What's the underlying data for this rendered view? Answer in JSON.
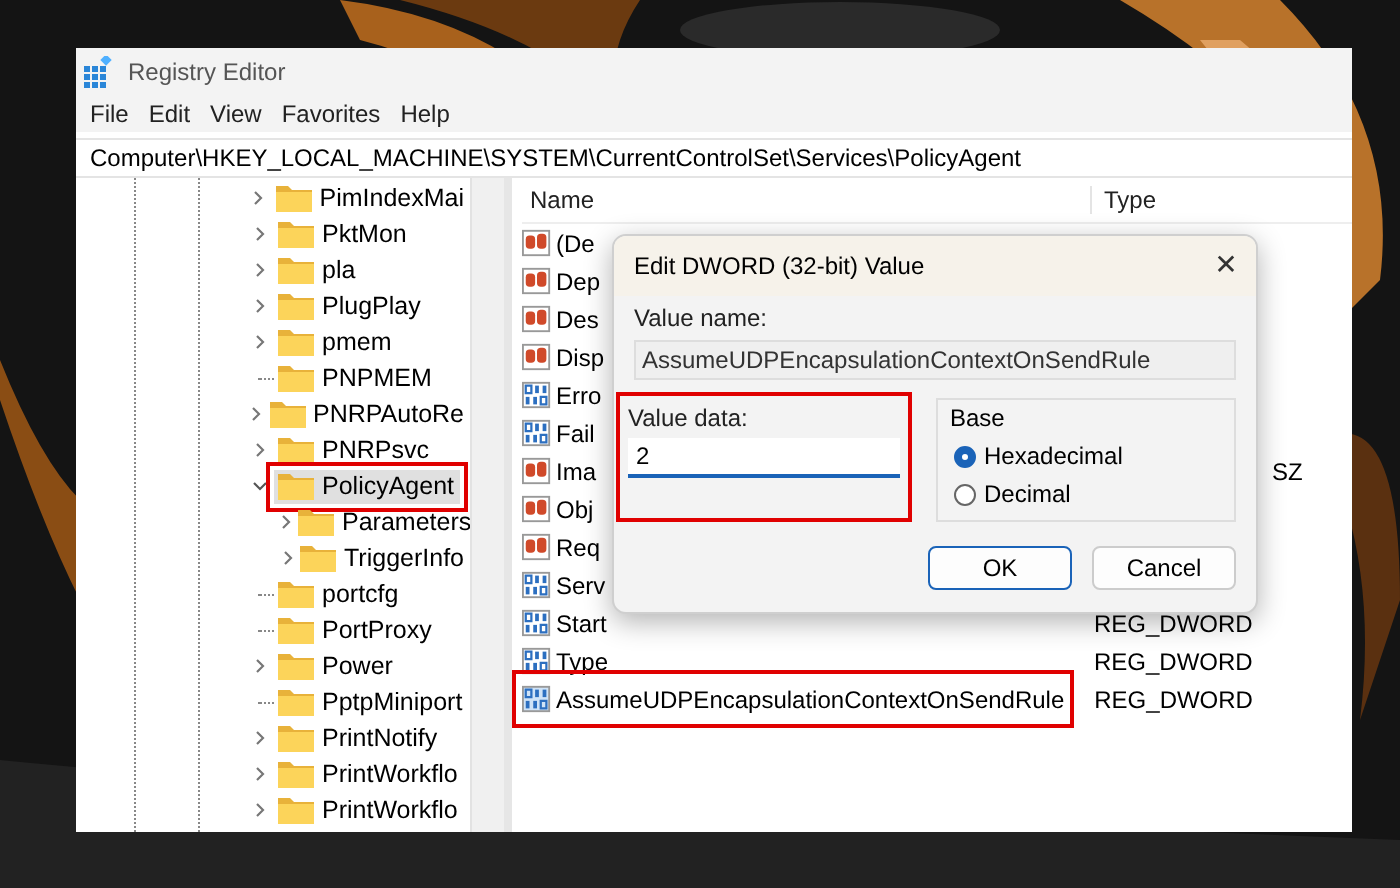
{
  "window": {
    "title": "Registry Editor"
  },
  "menu": [
    "File",
    "Edit",
    "View",
    "Favorites",
    "Help"
  ],
  "address": "Computer\\HKEY_LOCAL_MACHINE\\SYSTEM\\CurrentControlSet\\Services\\PolicyAgent",
  "tree": [
    {
      "label": "PimIndexMai",
      "has_children": true,
      "expanded": false,
      "selected": false,
      "highlighted": false
    },
    {
      "label": "PktMon",
      "has_children": true,
      "expanded": false,
      "selected": false,
      "highlighted": false
    },
    {
      "label": "pla",
      "has_children": true,
      "expanded": false,
      "selected": false,
      "highlighted": false
    },
    {
      "label": "PlugPlay",
      "has_children": true,
      "expanded": false,
      "selected": false,
      "highlighted": false
    },
    {
      "label": "pmem",
      "has_children": true,
      "expanded": false,
      "selected": false,
      "highlighted": false
    },
    {
      "label": "PNPMEM",
      "has_children": false,
      "selected": false,
      "highlighted": false
    },
    {
      "label": "PNRPAutoRe",
      "has_children": true,
      "expanded": false,
      "selected": false,
      "highlighted": false
    },
    {
      "label": "PNRPsvc",
      "has_children": true,
      "expanded": false,
      "selected": false,
      "highlighted": false
    },
    {
      "label": "PolicyAgent",
      "has_children": true,
      "expanded": true,
      "selected": true,
      "highlighted": true,
      "children": [
        {
          "label": "Parameters",
          "has_children": true,
          "expanded": false,
          "selected": false,
          "highlighted": false
        },
        {
          "label": "TriggerInfo",
          "has_children": true,
          "expanded": false,
          "selected": false,
          "highlighted": false
        }
      ]
    },
    {
      "label": "portcfg",
      "has_children": false,
      "selected": false,
      "highlighted": false
    },
    {
      "label": "PortProxy",
      "has_children": false,
      "selected": false,
      "highlighted": false
    },
    {
      "label": "Power",
      "has_children": true,
      "expanded": false,
      "selected": false,
      "highlighted": false
    },
    {
      "label": "PptpMiniport",
      "has_children": false,
      "selected": false,
      "highlighted": false
    },
    {
      "label": "PrintNotify",
      "has_children": true,
      "expanded": false,
      "selected": false,
      "highlighted": false
    },
    {
      "label": "PrintWorkflo",
      "has_children": true,
      "expanded": false,
      "selected": false,
      "highlighted": false
    },
    {
      "label": "PrintWorkflo",
      "has_children": true,
      "expanded": false,
      "selected": false,
      "highlighted": false
    }
  ],
  "list": {
    "columns": [
      "Name",
      "Type"
    ],
    "rows": [
      {
        "kind": "string",
        "name": "(De",
        "highlighted": false
      },
      {
        "kind": "string",
        "name": "Dep",
        "highlighted": false
      },
      {
        "kind": "string",
        "name": "Des",
        "highlighted": false
      },
      {
        "kind": "string",
        "name": "Disp",
        "highlighted": false
      },
      {
        "kind": "binary",
        "name": "Erro",
        "highlighted": false
      },
      {
        "kind": "binary",
        "name": "Fail",
        "highlighted": false
      },
      {
        "kind": "string",
        "name": "Ima",
        "type": "SZ",
        "highlighted": false
      },
      {
        "kind": "string",
        "name": "Obj",
        "highlighted": false
      },
      {
        "kind": "string",
        "name": "Req",
        "highlighted": false
      },
      {
        "kind": "binary",
        "name": "Serv",
        "highlighted": false
      },
      {
        "kind": "binary",
        "name": "Start",
        "type": "REG_DWORD",
        "highlighted": false
      },
      {
        "kind": "binary",
        "name": "Type",
        "type": "REG_DWORD",
        "highlighted": false
      },
      {
        "kind": "binary",
        "name": "AssumeUDPEncapsulationContextOnSendRule",
        "type": "REG_DWORD",
        "highlighted": true
      }
    ]
  },
  "dialog": {
    "title": "Edit DWORD (32-bit) Value",
    "close": "✕",
    "value_name_label": "Value name:",
    "value_name": "AssumeUDPEncapsulationContextOnSendRule",
    "value_data_label": "Value data:",
    "value_data": "2",
    "value_data_highlighted": true,
    "base_label": "Base",
    "bases": [
      {
        "label": "Hexadecimal",
        "selected": true
      },
      {
        "label": "Decimal",
        "selected": false
      }
    ],
    "buttons": [
      "OK",
      "Cancel"
    ]
  }
}
